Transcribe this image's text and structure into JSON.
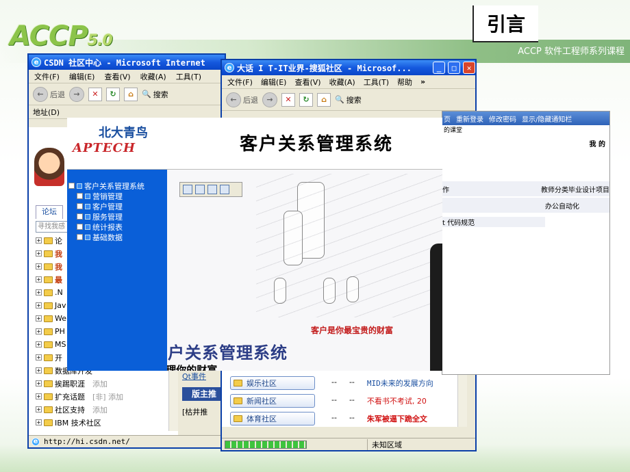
{
  "slide": {
    "logo": "ACCP",
    "logo_version": "5.0",
    "course": "ACCP 软件工程师系列课程",
    "title": "引言"
  },
  "csdn_window": {
    "title": "CSDN 社区中心 - Microsoft Internet",
    "menu": [
      "文件(F)",
      "编辑(E)",
      "查看(V)",
      "收藏(A)",
      "工具(T)"
    ],
    "back_label": "后退",
    "search_label": "搜索",
    "address_label": "地址(D)",
    "tab_forum": "论坛",
    "search_placeholder": "寻找我感",
    "tree": [
      {
        "label": "论",
        "add": ""
      },
      {
        "label": "我",
        "add": ""
      },
      {
        "label": "我",
        "add": ""
      },
      {
        "label": "最",
        "add": ""
      },
      {
        "label": ".N",
        "add": ""
      },
      {
        "label": "Jav",
        "add": ""
      },
      {
        "label": "We",
        "add": ""
      },
      {
        "label": "PH",
        "add": ""
      },
      {
        "label": "MS",
        "add": ""
      },
      {
        "label": "开",
        "add": ""
      },
      {
        "label": "数据库开发",
        "add": ""
      },
      {
        "label": "挨踢职涯",
        "add": "添加"
      },
      {
        "label": "扩充话题",
        "add": "[非] 添加"
      },
      {
        "label": "社区支持",
        "add": "添加"
      },
      {
        "label": "IBM 技术社区",
        "add": ""
      }
    ],
    "status_url": "http://hi.csdn.net/"
  },
  "sohu_window": {
    "title": "大话 I T-IT业界-搜狐社区 - Microsof...",
    "menu": [
      "文件(F)",
      "编辑(E)",
      "查看(V)",
      "收藏(A)",
      "工具(T)",
      "帮助"
    ],
    "back_label": "后退",
    "search_label": "搜索",
    "left_links": [
      "Qt事件",
      "版主推",
      "[枯井推"
    ],
    "communities": [
      "娱乐社区",
      "新闻社区",
      "体育社区"
    ],
    "news": [
      {
        "a": "--",
        "b": "--",
        "text": "MID未来的发展方向"
      },
      {
        "a": "--",
        "b": "--",
        "text": "不看书不考试, 20"
      },
      {
        "a": "--",
        "b": "--",
        "text": "朱军被逼下跪全文"
      }
    ],
    "status_zone": "未知区域"
  },
  "crm": {
    "logo_cn": "北大青鸟",
    "logo_en": "APTECH",
    "title": "客户关系管理系统",
    "nav": [
      {
        "label": "客户关系管理系统",
        "level": 0
      },
      {
        "label": "营销管理",
        "level": 1
      },
      {
        "label": "客户管理",
        "level": 1
      },
      {
        "label": "服务管理",
        "level": 1
      },
      {
        "label": "统计报表",
        "level": 1
      },
      {
        "label": "基础数据",
        "level": 1
      }
    ],
    "slogan": "客户是你最宝贵的财富",
    "welcome": "欢迎使用客户关系管理系统",
    "sub": "管理你的客户 管理你的财富"
  },
  "admin_panel": {
    "bar": [
      "页",
      "重新登录",
      "修改密码",
      "显示/隐藏通知栏"
    ],
    "sub": "的课堂",
    "me": "我 的",
    "rows": [
      {
        "left": "作",
        "right": "教师分类毕业设计项目"
      },
      {
        "left": "",
        "right": "办公自动化"
      },
      {
        "left": "t 代码规范",
        "right": ""
      }
    ]
  }
}
